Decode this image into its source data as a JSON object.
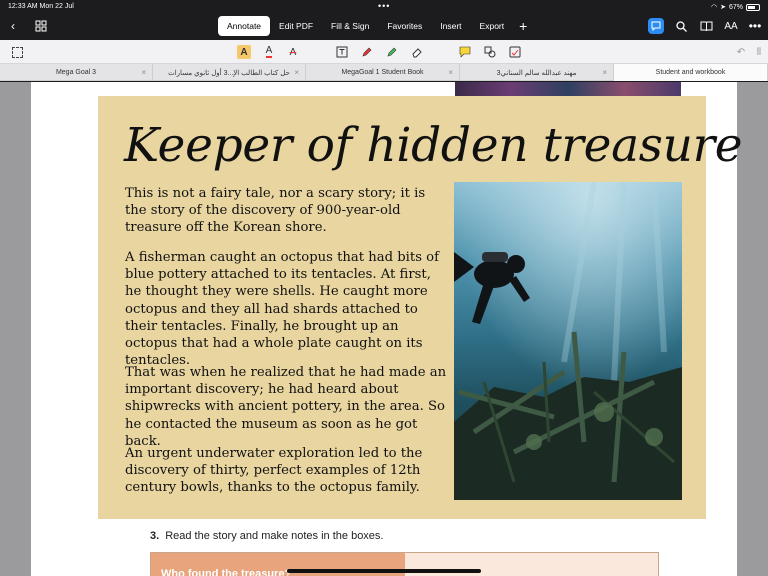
{
  "status": {
    "time": "12:33 AM  Mon 22 Jul",
    "battery": "67%"
  },
  "toolbar": {
    "tabs": [
      "Annotate",
      "Edit PDF",
      "Fill & Sign",
      "Favorites",
      "Insert",
      "Export"
    ],
    "active_tab": "Annotate",
    "font_label": "AA"
  },
  "file_tabs": [
    {
      "label": "Mega Goal 3",
      "active": false
    },
    {
      "label": "حل كتاب الطالب الإ...3 أول ثانوي مسارات",
      "active": false
    },
    {
      "label": "MegaGoal 1 Student Book",
      "active": false
    },
    {
      "label": "مهند عبدالله سالم السناني3",
      "active": false
    },
    {
      "label": "Student and workbook",
      "active": true
    }
  ],
  "article": {
    "title": "Keeper of hidden treasure",
    "paragraphs": [
      "This is not a fairy tale, nor a scary story; it is the story of the discovery of 900-year-old treasure off the Korean shore.",
      "A fisherman caught an octopus that had bits of blue pottery attached to its tentacles. At first, he thought they were shells. He caught more octopus and they all had shards attached to their tentacles. Finally, he brought up an octopus that had a whole plate caught on its tentacles.",
      "That was when he realized that he had made an important discovery; he had heard about shipwrecks with ancient pottery, in the area. So he contacted the museum as soon as he got back.",
      "An urgent underwater exploration led to the discovery of thirty, perfect examples of 12th century bowls, thanks to the octopus family."
    ]
  },
  "exercise": {
    "number": "3.",
    "instruction": "Read the story and make notes in the boxes.",
    "box_heading": "Who found the treasure?"
  },
  "colors": {
    "accent": "#2c8cf4",
    "article_bg": "#e8d5a0",
    "box_header": "#e8a47d"
  }
}
